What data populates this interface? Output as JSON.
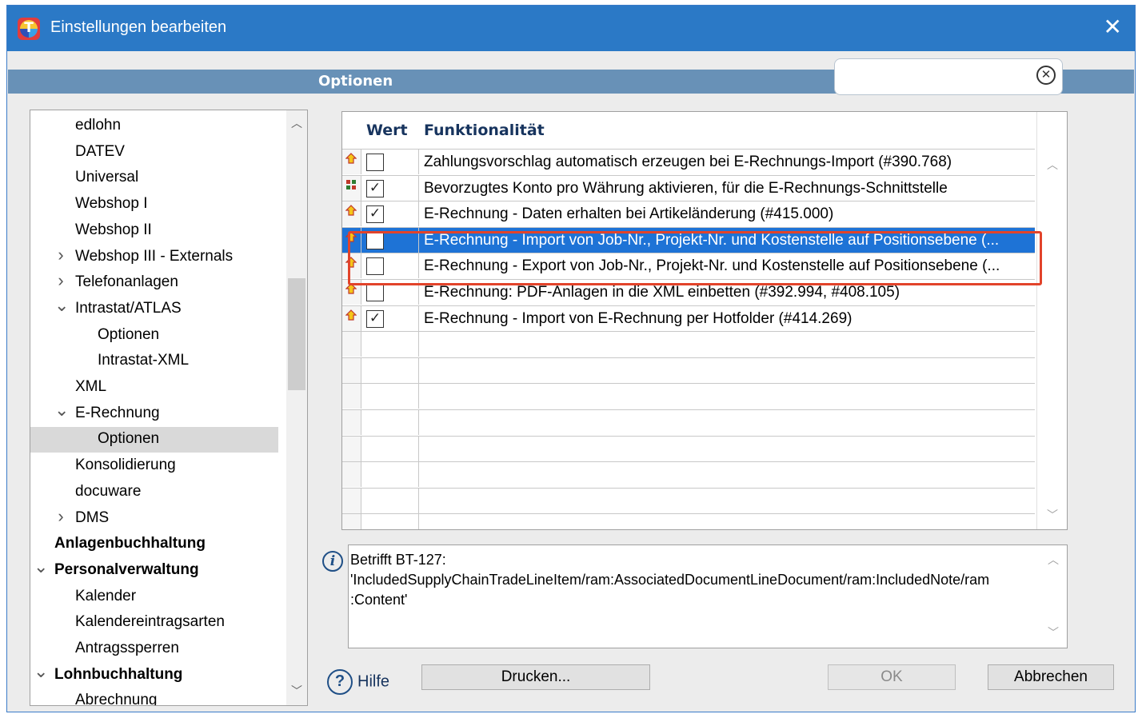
{
  "window": {
    "title": "Einstellungen bearbeiten"
  },
  "header": {
    "title": "Optionen",
    "search_value": ""
  },
  "tree": {
    "items": [
      {
        "label": "edlohn",
        "expander": ""
      },
      {
        "label": "DATEV",
        "expander": ""
      },
      {
        "label": "Universal",
        "expander": ""
      },
      {
        "label": "Webshop I",
        "expander": ""
      },
      {
        "label": "Webshop II",
        "expander": ""
      },
      {
        "label": "Webshop III - Externals",
        "expander": ">"
      },
      {
        "label": "Telefonanlagen",
        "expander": ">"
      },
      {
        "label": "Intrastat/ATLAS",
        "expander": "v"
      },
      {
        "label": "Optionen",
        "expander": ""
      },
      {
        "label": "Intrastat-XML",
        "expander": ""
      },
      {
        "label": "XML",
        "expander": ""
      },
      {
        "label": "E-Rechnung",
        "expander": "v"
      },
      {
        "label": "Optionen",
        "expander": ""
      },
      {
        "label": "Konsolidierung",
        "expander": ""
      },
      {
        "label": "docuware",
        "expander": ""
      },
      {
        "label": "DMS",
        "expander": ">"
      },
      {
        "label": "Anlagenbuchhaltung",
        "expander": ""
      },
      {
        "label": "Personalverwaltung",
        "expander": "v"
      },
      {
        "label": "Kalender",
        "expander": ""
      },
      {
        "label": "Kalendereintragsarten",
        "expander": ""
      },
      {
        "label": "Antragssperren",
        "expander": ""
      },
      {
        "label": "Lohnbuchhaltung",
        "expander": "v"
      },
      {
        "label": "Abrechnung",
        "expander": ""
      }
    ]
  },
  "grid": {
    "col_wert": "Wert",
    "col_funktion": "Funktionalität",
    "rows": [
      {
        "checked": false,
        "pin": "up",
        "text": "Zahlungsvorschlag automatisch erzeugen bei E-Rechnungs-Import (#390.768)"
      },
      {
        "checked": true,
        "pin": "sync",
        "text": "Bevorzugtes Konto pro Währung aktivieren, für die E-Rechnungs-Schnittstelle"
      },
      {
        "checked": true,
        "pin": "up",
        "text": "E-Rechnung - Daten erhalten bei Artikeländerung (#415.000)"
      },
      {
        "checked": false,
        "pin": "up",
        "text": "E-Rechnung - Import von Job-Nr., Projekt-Nr. und Kostenstelle auf Positionsebene (..."
      },
      {
        "checked": false,
        "pin": "up",
        "text": "E-Rechnung - Export von Job-Nr., Projekt-Nr. und Kostenstelle auf Positionsebene (..."
      },
      {
        "checked": false,
        "pin": "up",
        "text": "E-Rechnung: PDF-Anlagen in die XML einbetten (#392.994, #408.105)"
      },
      {
        "checked": true,
        "pin": "up",
        "text": "E-Rechnung - Import von E-Rechnung per Hotfolder (#414.269)"
      }
    ]
  },
  "info": {
    "line1": "Betrifft BT-127:",
    "line2": "'IncludedSupplyChainTradeLineItem/ram:AssociatedDocumentLineDocument/ram:IncludedNote/ram",
    "line3": ":Content'"
  },
  "buttons": {
    "help": "Hilfe",
    "print": "Drucken...",
    "ok": "OK",
    "cancel": "Abbrechen"
  },
  "colors": {
    "titlebar": "#2b79c6",
    "header_band": "#6891b7",
    "selection": "#1e73d6",
    "highlight": "#e2432a"
  }
}
